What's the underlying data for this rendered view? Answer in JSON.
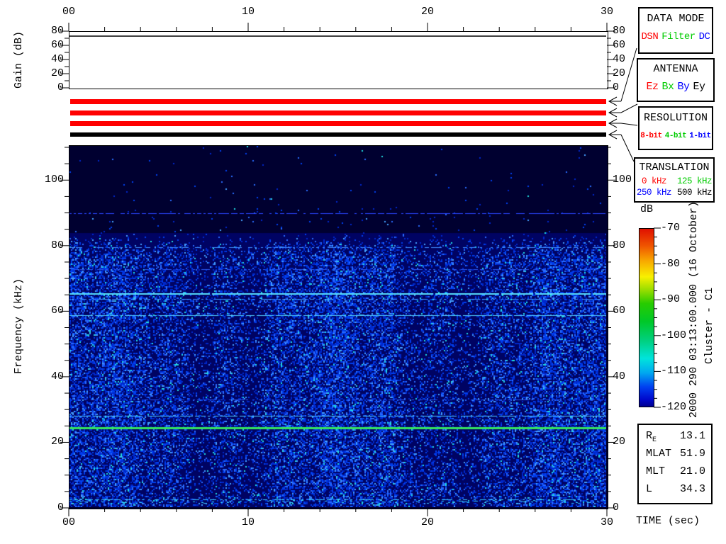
{
  "axis_titles": {
    "gain": "Gain (dB)",
    "frequency": "Frequency (kHz)"
  },
  "top_axis": {
    "tick_labels": [
      "00",
      "10",
      "20",
      "30"
    ]
  },
  "bottom_axis": {
    "tick_labels": [
      "00",
      "10",
      "20",
      "30"
    ],
    "label": "TIME (sec)"
  },
  "gain_axis": {
    "tick_labels": [
      "0",
      "20",
      "40",
      "60",
      "80"
    ]
  },
  "freq_axis": {
    "tick_labels": [
      "0",
      "20",
      "40",
      "60",
      "80",
      "100"
    ]
  },
  "colorbar": {
    "title": "dB",
    "tick_labels": [
      "-70",
      "-80",
      "-90",
      "-100",
      "-110",
      "-120"
    ]
  },
  "side_annotation": {
    "datetime": "2000 290 03:13:00.000 (16 October)",
    "spacecraft": "Cluster - C1"
  },
  "panels": {
    "data_mode": {
      "title": "DATA MODE",
      "options": [
        {
          "label": "DSN",
          "color": "#ff0000"
        },
        {
          "label": "Filter",
          "color": "#00cc00"
        },
        {
          "label": "DC",
          "color": "#0000ff"
        }
      ]
    },
    "antenna": {
      "title": "ANTENNA",
      "options": [
        {
          "label": "Ez",
          "color": "#ff0000"
        },
        {
          "label": "Bx",
          "color": "#00cc00"
        },
        {
          "label": "By",
          "color": "#0000ff"
        },
        {
          "label": "Ey",
          "color": "#000000"
        }
      ]
    },
    "resolution": {
      "title": "RESOLUTION",
      "options": [
        {
          "label": "8-bit",
          "color": "#ff0000"
        },
        {
          "label": "4-bit",
          "color": "#00cc00"
        },
        {
          "label": "1-bit",
          "color": "#0000ff"
        }
      ]
    },
    "translation": {
      "title": "TRANSLATION",
      "options": [
        {
          "label": "0 kHz",
          "color": "#ff0000"
        },
        {
          "label": "125 kHz",
          "color": "#00cc00"
        },
        {
          "label": "250 kHz",
          "color": "#0000ff"
        },
        {
          "label": "500 kHz",
          "color": "#000000"
        }
      ]
    }
  },
  "status_bars": [
    {
      "panel": "DATA MODE",
      "selected": "DSN",
      "color": "#ff0000"
    },
    {
      "panel": "ANTENNA",
      "selected": "Ez",
      "color": "#ff0000"
    },
    {
      "panel": "RESOLUTION",
      "selected": "8-bit",
      "color": "#ff0000"
    },
    {
      "panel": "TRANSLATION",
      "selected": "500 kHz",
      "color": "#000000"
    }
  ],
  "ephemeris": {
    "rows": [
      {
        "label": "R",
        "sub": "E",
        "value": "13.1"
      },
      {
        "label": "MLAT",
        "sub": "",
        "value": "51.9"
      },
      {
        "label": "MLT",
        "sub": "",
        "value": "21.0"
      },
      {
        "label": "L",
        "sub": "",
        "value": "34.3"
      }
    ]
  },
  "chart_data": [
    {
      "type": "line",
      "title": "Gain (dB)",
      "xlabel": "TIME (sec)",
      "ylabel": "Gain (dB)",
      "x_range_sec": [
        0,
        30
      ],
      "ylim": [
        0,
        80
      ],
      "x_tick_labels": [
        "00",
        "10",
        "20",
        "30"
      ],
      "y_ticks": [
        0,
        20,
        40,
        60,
        80
      ],
      "series": [
        {
          "name": "receiver-gain",
          "shape": "constant",
          "value_db": 73
        }
      ]
    },
    {
      "type": "heatmap",
      "title": "Cluster C1 WBD spectrogram",
      "xlabel": "TIME (sec)",
      "ylabel": "Frequency (kHz)",
      "x_range_sec": [
        0,
        30
      ],
      "y_range_khz": [
        0,
        110.7
      ],
      "x_tick_labels": [
        "00",
        "10",
        "20",
        "30"
      ],
      "y_tick_labels": [
        "0",
        "20",
        "40",
        "60",
        "80",
        "100"
      ],
      "color_scale": {
        "label": "dB",
        "min": -120,
        "max": -70,
        "ticks": [
          -70,
          -80,
          -90,
          -100,
          -110,
          -120
        ]
      },
      "noise_band": {
        "upper_edge_khz": 84,
        "typical_db": -113,
        "above_edge_db": -120
      },
      "spectral_lines_khz": [
        {
          "khz": 90.0,
          "db": -113,
          "color": "#2a46ff",
          "px": 1,
          "gap": 0.3
        },
        {
          "khz": 79.5,
          "db": -111,
          "color": "#3f8cff",
          "px": 1,
          "gap": 0.45
        },
        {
          "khz": 72.8,
          "db": -114,
          "color": "#2a55ee",
          "px": 1,
          "gap": 0.6
        },
        {
          "khz": 65.4,
          "db": -104,
          "color": "#58e4ff",
          "px": 2,
          "gap": 0.04
        },
        {
          "khz": 63.6,
          "db": -110,
          "color": "#3f9bff",
          "px": 1,
          "gap": 0.45
        },
        {
          "khz": 58.8,
          "db": -106,
          "color": "#4fd0ff",
          "px": 1,
          "gap": 0.12
        },
        {
          "khz": 32.8,
          "db": -113,
          "color": "#2a55ee",
          "px": 1,
          "gap": 0.55
        },
        {
          "khz": 28.0,
          "db": -106,
          "color": "#4fd0ff",
          "px": 1,
          "gap": 0.15
        },
        {
          "khz": 24.2,
          "db": -93,
          "color": "#35e55f",
          "px": 3,
          "gap": 0.0
        },
        {
          "khz": 2.2,
          "db": -107,
          "color": "#3ac8ff",
          "px": 1,
          "gap": 0.5
        }
      ]
    }
  ]
}
